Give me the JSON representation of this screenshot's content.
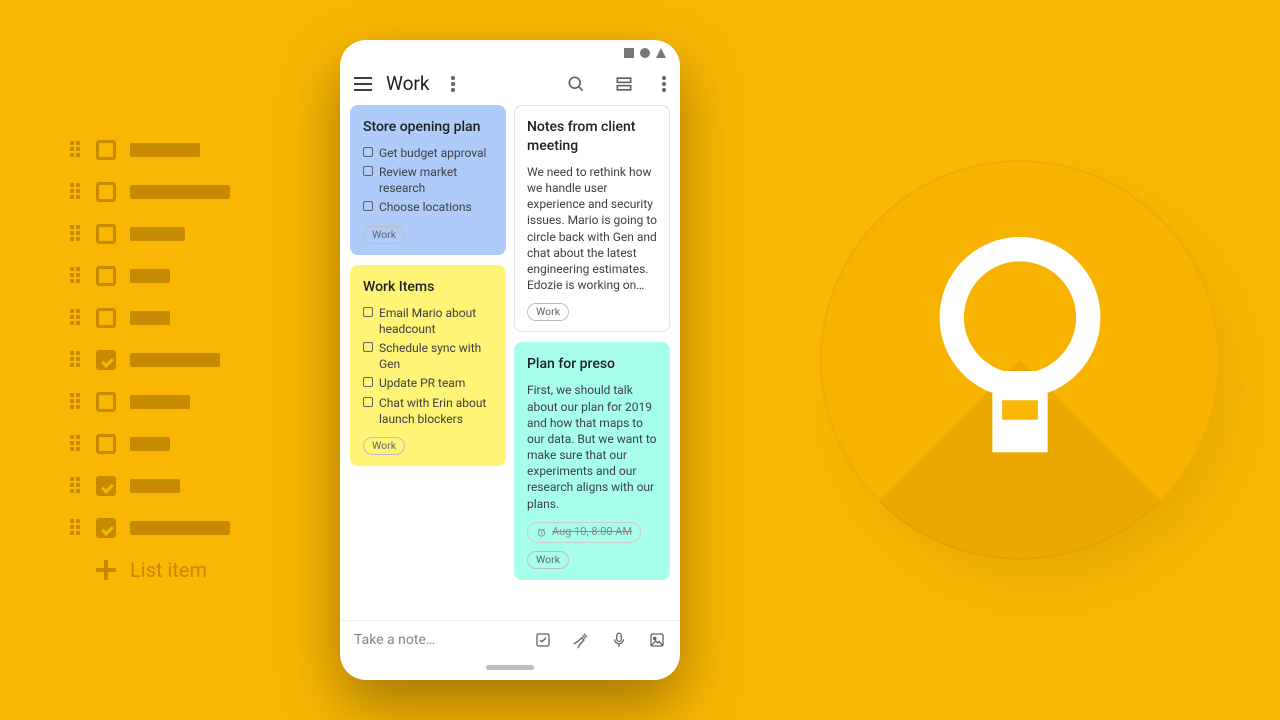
{
  "deco": {
    "rows": [
      {
        "checked": false,
        "width": 70
      },
      {
        "checked": false,
        "width": 100
      },
      {
        "checked": false,
        "width": 55
      },
      {
        "checked": false,
        "width": 40
      },
      {
        "checked": false,
        "width": 40
      },
      {
        "checked": true,
        "width": 90
      },
      {
        "checked": false,
        "width": 60
      },
      {
        "checked": false,
        "width": 40
      },
      {
        "checked": true,
        "width": 50
      },
      {
        "checked": true,
        "width": 100
      }
    ],
    "add_label": "List item"
  },
  "appbar": {
    "title": "Work"
  },
  "cards": {
    "left": [
      {
        "color": "blue",
        "title": "Store opening plan",
        "items": [
          "Get budget approval",
          "Review market research",
          "Choose locations"
        ],
        "tag": "Work"
      },
      {
        "color": "yellow",
        "title": "Work Items",
        "items": [
          "Email Mario about headcount",
          "Schedule sync with Gen",
          "Update PR team",
          "Chat with Erin about launch blockers"
        ],
        "tag": "Work"
      }
    ],
    "right": [
      {
        "color": "white",
        "title": "Notes from client meeting",
        "body": "We need to rethink how we handle user experience and security issues. Mario is going to circle back with Gen and chat about the latest engineering estimates. Edozie is working on…",
        "tag": "Work"
      },
      {
        "color": "teal",
        "title": "Plan for preso",
        "body": "First, we should talk about our plan for 2019 and how that maps to our data. But we want to make sure that our experiments and our research aligns with our plans.",
        "reminder": "Aug 10, 8:00 AM",
        "tag": "Work"
      }
    ]
  },
  "bottombar": {
    "placeholder": "Take a note…"
  }
}
